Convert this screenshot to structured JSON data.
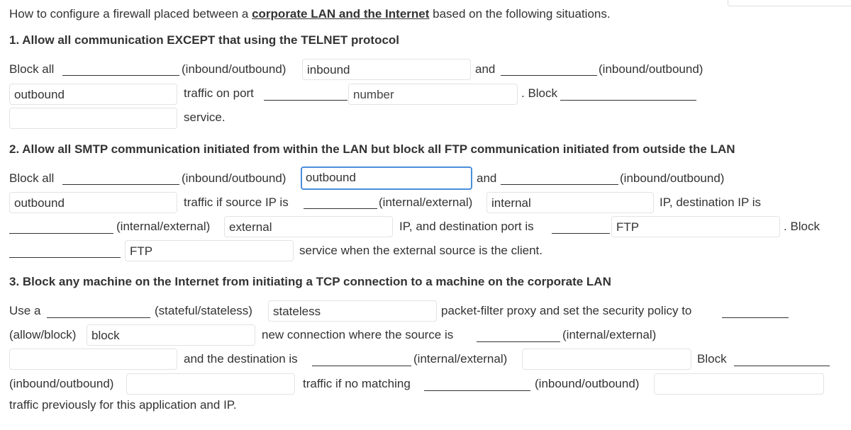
{
  "intro": {
    "prefix": "How to configure a firewall placed between a ",
    "link": "corporate LAN and the Internet",
    "suffix": " based on the following situations."
  },
  "q1": {
    "heading": "1. Allow all communication EXCEPT that using the TELNET protocol",
    "block_all": "Block all",
    "hint_io_1": "(inbound/outbound)",
    "input_1": "inbound",
    "and": "and",
    "hint_io_2": "(inbound/outbound)",
    "input_2": "outbound",
    "traffic_on_port": "traffic on port",
    "input_3_placeholder": "number",
    "block": ". Block",
    "input_4": "",
    "service": "service."
  },
  "q2": {
    "heading": "2. Allow all SMTP communication initiated from within the LAN but block all FTP communication initiated from outside the LAN",
    "block_all": "Block all",
    "hint_io_1": "(inbound/outbound)",
    "input_1": "outbound",
    "and": "and",
    "hint_io_2": "(inbound/outbound)",
    "input_2": "outbound",
    "source_ip": "traffic if source IP is",
    "hint_ie_1": "(internal/external)",
    "input_3": "internal",
    "dest_ip": "IP, destination IP is",
    "hint_ie_2": "(internal/external)",
    "input_4": "external",
    "dest_port": "IP, and destination port is",
    "input_5": "FTP",
    "block": ". Block",
    "input_6": "FTP",
    "service": "service when the external source is the client."
  },
  "q3": {
    "heading": "3. Block any machine on the Internet from initiating a TCP connection to a machine on the corporate LAN",
    "use_a": "Use a",
    "hint_ss": "(stateful/stateless)",
    "input_1": "stateless",
    "policy": "packet-filter proxy and set the security policy to",
    "hint_ab": "(allow/block)",
    "input_2": "block",
    "new_conn": "new connection where the source is",
    "hint_ie_1": "(internal/external)",
    "input_3": "",
    "dest_is": "and the destination is",
    "hint_ie_2": "(internal/external)",
    "input_4": "",
    "block": "Block",
    "hint_io_1": "(inbound/outbound)",
    "input_5": "",
    "no_matching": "traffic if no matching",
    "hint_io_2": "(inbound/outbound)",
    "input_6": "",
    "previously": "traffic previously for this application and IP."
  }
}
